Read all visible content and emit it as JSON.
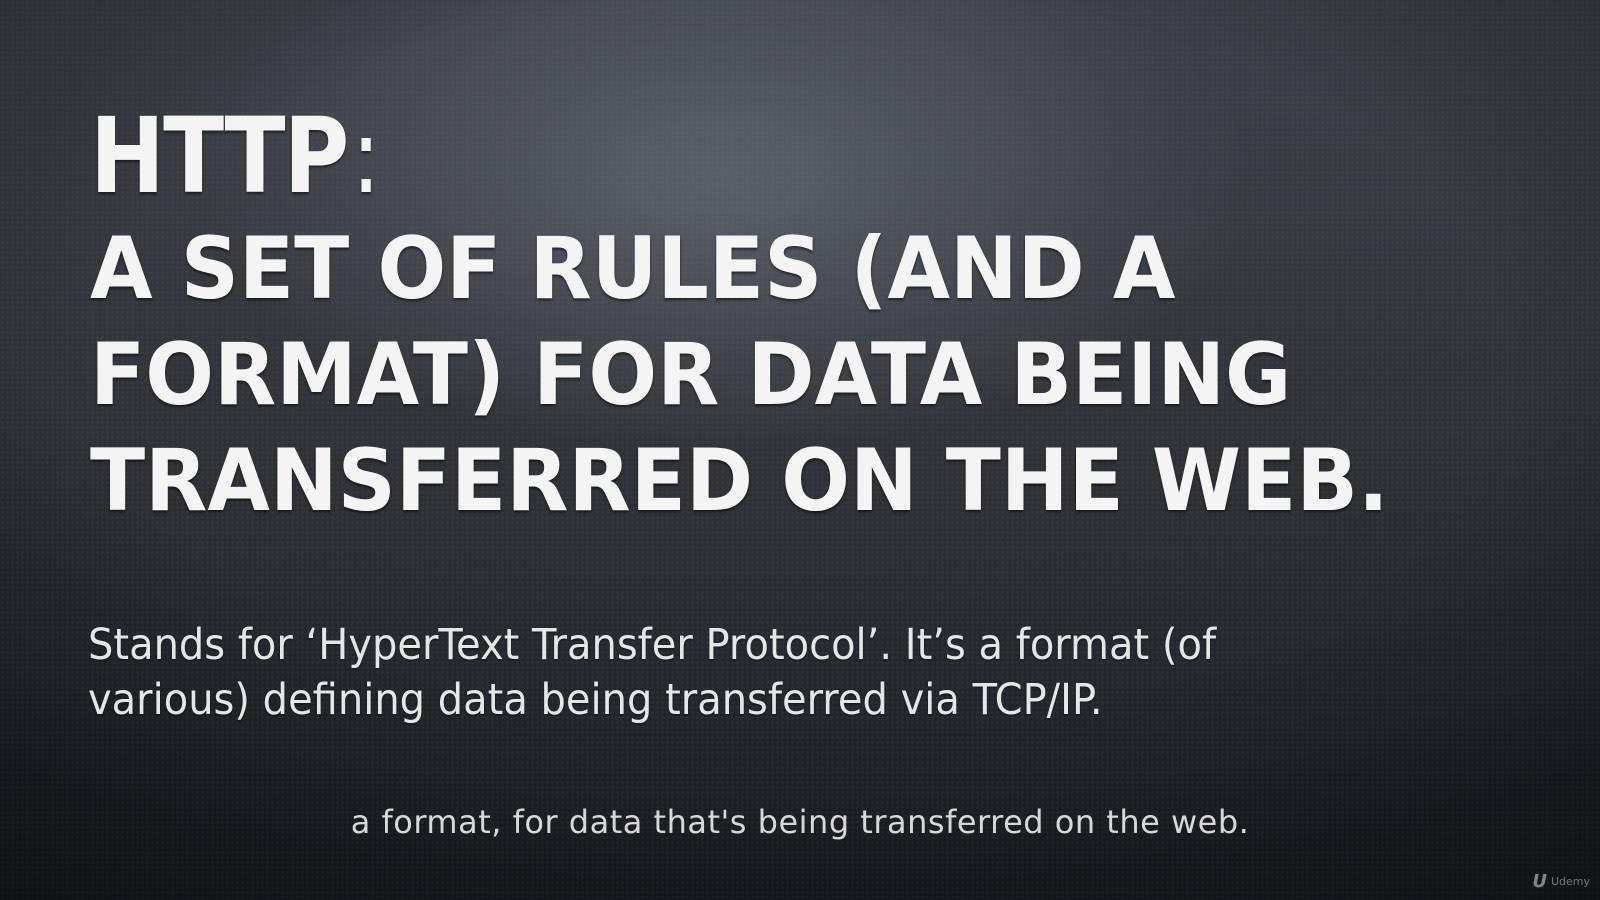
{
  "slide": {
    "title": "HTTP",
    "title_colon": ":",
    "subtitle": "A SET OF RULES (AND A\nFORMAT) FOR DATA BEING\nTRANSFERRED ON THE WEB.",
    "body": "Stands for ‘HyperText Transfer Protocol’. It’s a format (of\nvarious) defining data being transferred via TCP/IP."
  },
  "caption": {
    "text": "a format, for data that's being transferred on the web."
  },
  "watermark": {
    "logo": "U",
    "label": "Udemy"
  }
}
